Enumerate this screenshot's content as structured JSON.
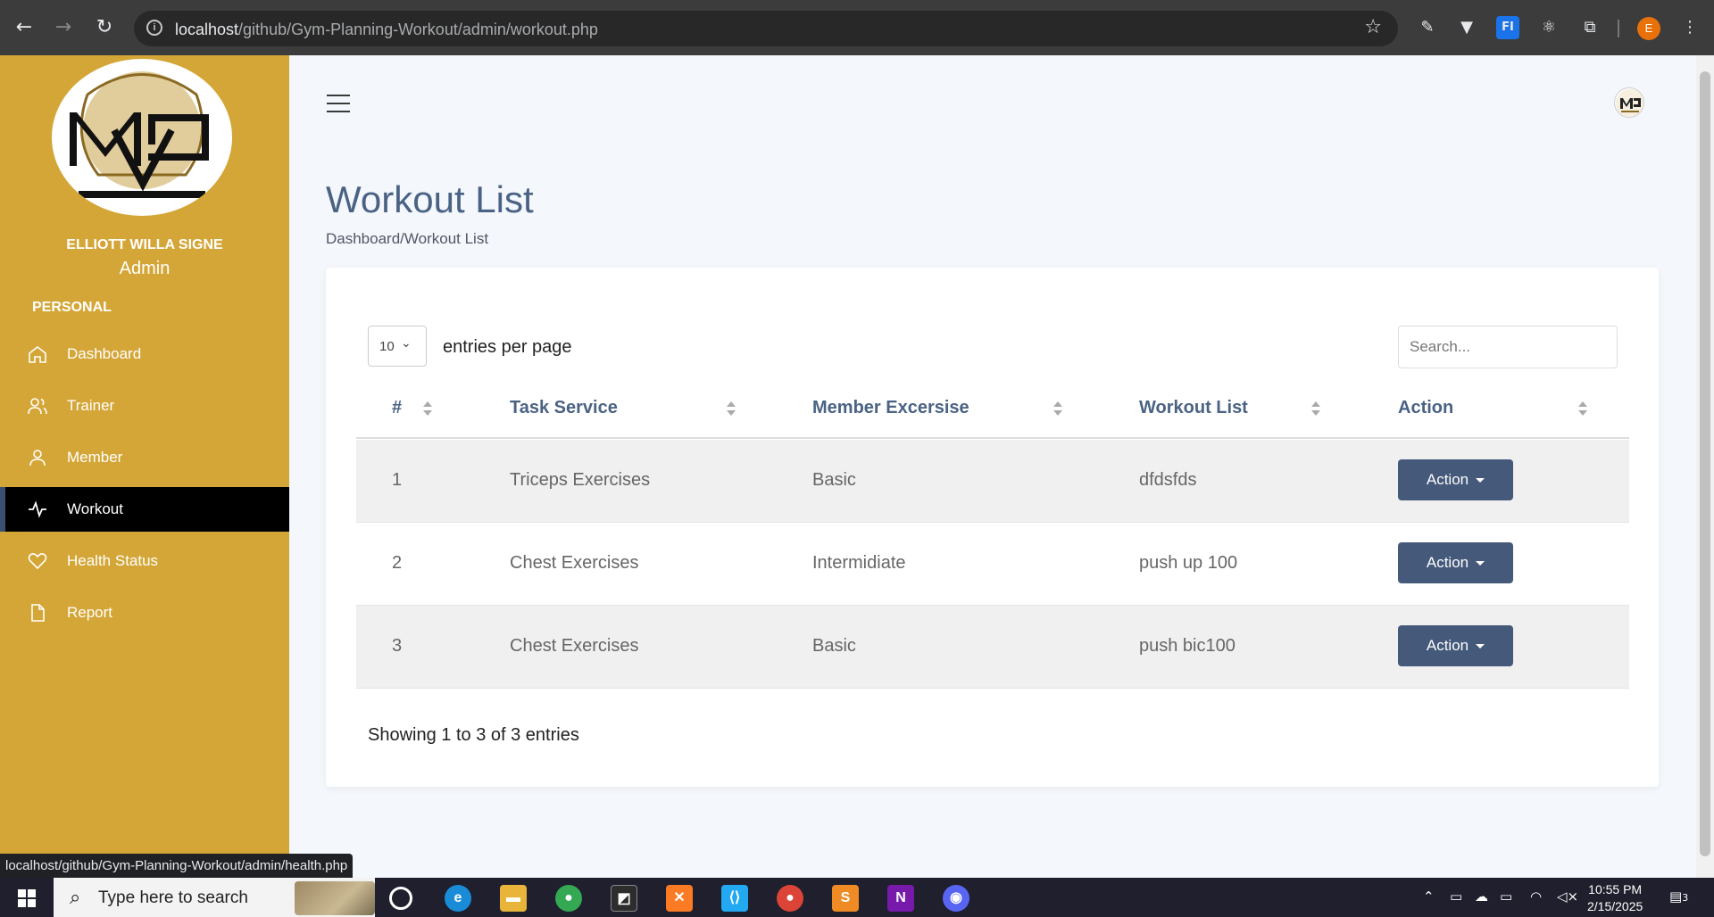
{
  "browser": {
    "url_host": "localhost",
    "url_path": "/github/Gym-Planning-Workout/admin/workout.php",
    "profile_initial": "E"
  },
  "sidebar": {
    "user_name": "ELLIOTT WILLA SIGNE",
    "user_role": "Admin",
    "section_label": "PERSONAL",
    "items": [
      {
        "label": "Dashboard",
        "icon": "home-icon"
      },
      {
        "label": "Trainer",
        "icon": "users-icon"
      },
      {
        "label": "Member",
        "icon": "user-icon"
      },
      {
        "label": "Workout",
        "icon": "activity-icon",
        "active": true
      },
      {
        "label": "Health Status",
        "icon": "heart-icon"
      },
      {
        "label": "Report",
        "icon": "file-icon"
      }
    ]
  },
  "page": {
    "title": "Workout List",
    "breadcrumb": "Dashboard/Workout List"
  },
  "table": {
    "per_page_value": "10",
    "per_page_label": "entries per page",
    "search_placeholder": "Search...",
    "headers": [
      "#",
      "Task Service",
      "Member Excersise",
      "Workout List",
      "Action"
    ],
    "rows": [
      {
        "num": "1",
        "task": "Triceps Exercises",
        "member": "Basic",
        "workout": "dfdsfds",
        "action": "Action"
      },
      {
        "num": "2",
        "task": "Chest Exercises",
        "member": "Intermidiate",
        "workout": "push up 100",
        "action": "Action"
      },
      {
        "num": "3",
        "task": "Chest Exercises",
        "member": "Basic",
        "workout": "push bic100",
        "action": "Action"
      }
    ],
    "footer": "Showing 1 to 3 of 3 entries"
  },
  "status_bar": {
    "hover_url": "localhost/github/Gym-Planning-Workout/admin/health.php"
  },
  "taskbar": {
    "search_placeholder": "Type here to search",
    "time": "10:55 PM",
    "date": "2/15/2025",
    "notification_count": "3"
  },
  "colors": {
    "sidebar": "#d4a637",
    "accent": "#45597a",
    "title": "#4a6284"
  }
}
